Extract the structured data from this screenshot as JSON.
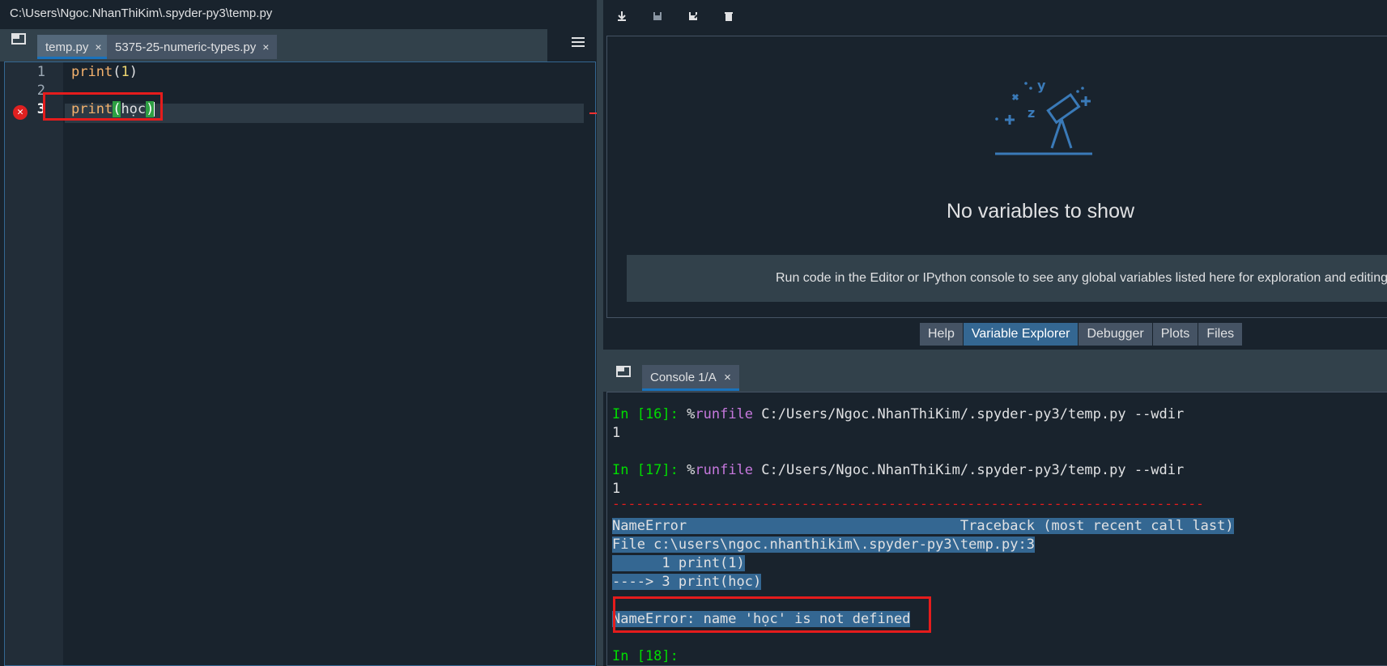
{
  "window": {
    "path": "C:\\Users\\Ngoc.NhanThiKim\\.spyder-py3\\temp.py"
  },
  "editor": {
    "tabs": [
      {
        "label": "temp.py",
        "close": "×"
      },
      {
        "label": "5375-25-numeric-types.py",
        "close": "×"
      }
    ],
    "lines": [
      {
        "num": "1",
        "kw": "print",
        "open": "(",
        "arg": "1",
        "close": ")"
      },
      {
        "num": "2"
      },
      {
        "num": "3",
        "kw": "print",
        "open": "(",
        "arg": "học",
        "close": ")"
      }
    ],
    "error_icon": "✕"
  },
  "toolbar": {
    "icons": [
      "import-data-icon",
      "save-data-icon",
      "save-as-icon",
      "delete-icon"
    ]
  },
  "variable_explorer": {
    "empty_title": "No variables to show",
    "empty_info": "Run code in the Editor or IPython console to see any global variables listed here for exploration and editing."
  },
  "plugin_tabs": [
    "Help",
    "Variable Explorer",
    "Debugger",
    "Plots",
    "Files"
  ],
  "console": {
    "tab_label": "Console 1/A",
    "tab_close": "×",
    "in16_prompt": "In [16]:",
    "in16_pct": " %",
    "in16_cmd": "runfile",
    "in16_args": " C:/Users/Ngoc.NhanThiKim/.spyder-py3/temp.py --wdir",
    "out16": "1",
    "in17_prompt": "In [17]:",
    "in17_pct": " %",
    "in17_cmd": "runfile",
    "in17_args": " C:/Users/Ngoc.NhanThiKim/.spyder-py3/temp.py --wdir",
    "out17": "1",
    "dashes": "---------------------------------------------------------------------------",
    "tb_header": "NameError                                 Traceback (most recent call last)",
    "tb_file": "File c:\\users\\ngoc.nhanthikim\\.spyder-py3\\temp.py:3",
    "tb_line1": "      1 print(1)",
    "tb_line3": "----> 3 print(học)",
    "error_msg": "NameError: name 'học' is not defined",
    "in18_prompt": "In [18]:"
  }
}
